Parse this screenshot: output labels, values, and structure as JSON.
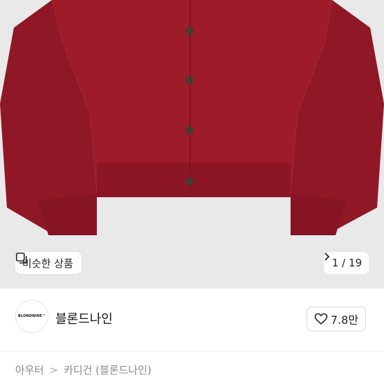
{
  "image": {
    "description_colors": {
      "background": "#e9e9e9",
      "sweater": "#9e1b2a",
      "button": "#4a3a30"
    }
  },
  "similar": {
    "label": "비슷한 상품",
    "icon": "similar-items-icon"
  },
  "pager": {
    "text": "1 / 19",
    "icon": "chevron-right-icon"
  },
  "shop": {
    "logo_text": "BLONDNINE™",
    "name": "블론드나인"
  },
  "like": {
    "count": "7.8만",
    "icon": "heart-icon"
  },
  "breadcrumb": {
    "level1": "아우터",
    "separator": ">",
    "level2": "카디건 (블론드나인)"
  }
}
